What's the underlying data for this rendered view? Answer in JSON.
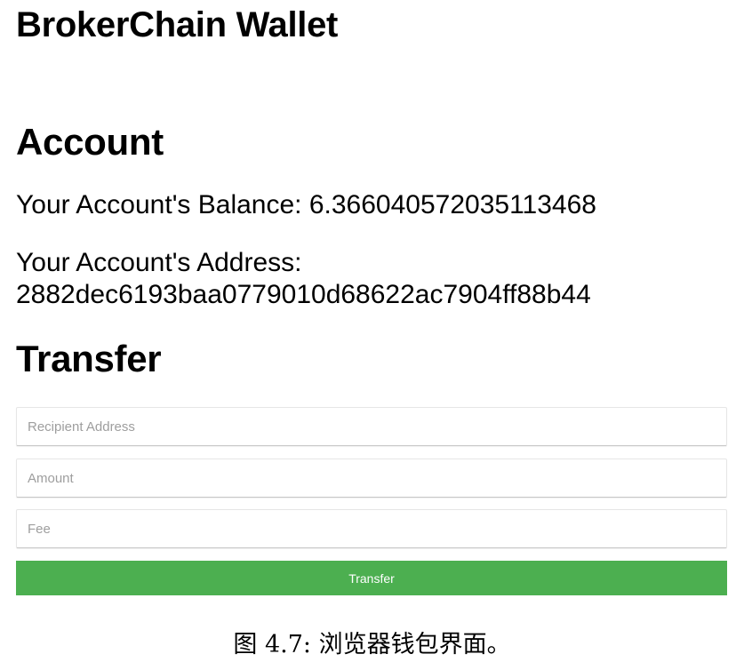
{
  "app": {
    "title": "BrokerChain Wallet"
  },
  "account": {
    "heading": "Account",
    "balance_text": "Your Account's Balance: 6.366040572035113468",
    "address_label": "Your Account's Address:",
    "address_value": "2882dec6193baa0779010d68622ac7904ff88b44"
  },
  "transfer": {
    "heading": "Transfer",
    "recipient_placeholder": "Recipient Address",
    "amount_placeholder": "Amount",
    "fee_placeholder": "Fee",
    "button_label": "Transfer"
  },
  "caption": {
    "text": "图 4.7: 浏览器钱包界面。"
  },
  "colors": {
    "button_bg": "#4caf50",
    "button_text": "#ffffff",
    "placeholder": "#9e9e9e",
    "field_border": "#e6e6e6"
  }
}
